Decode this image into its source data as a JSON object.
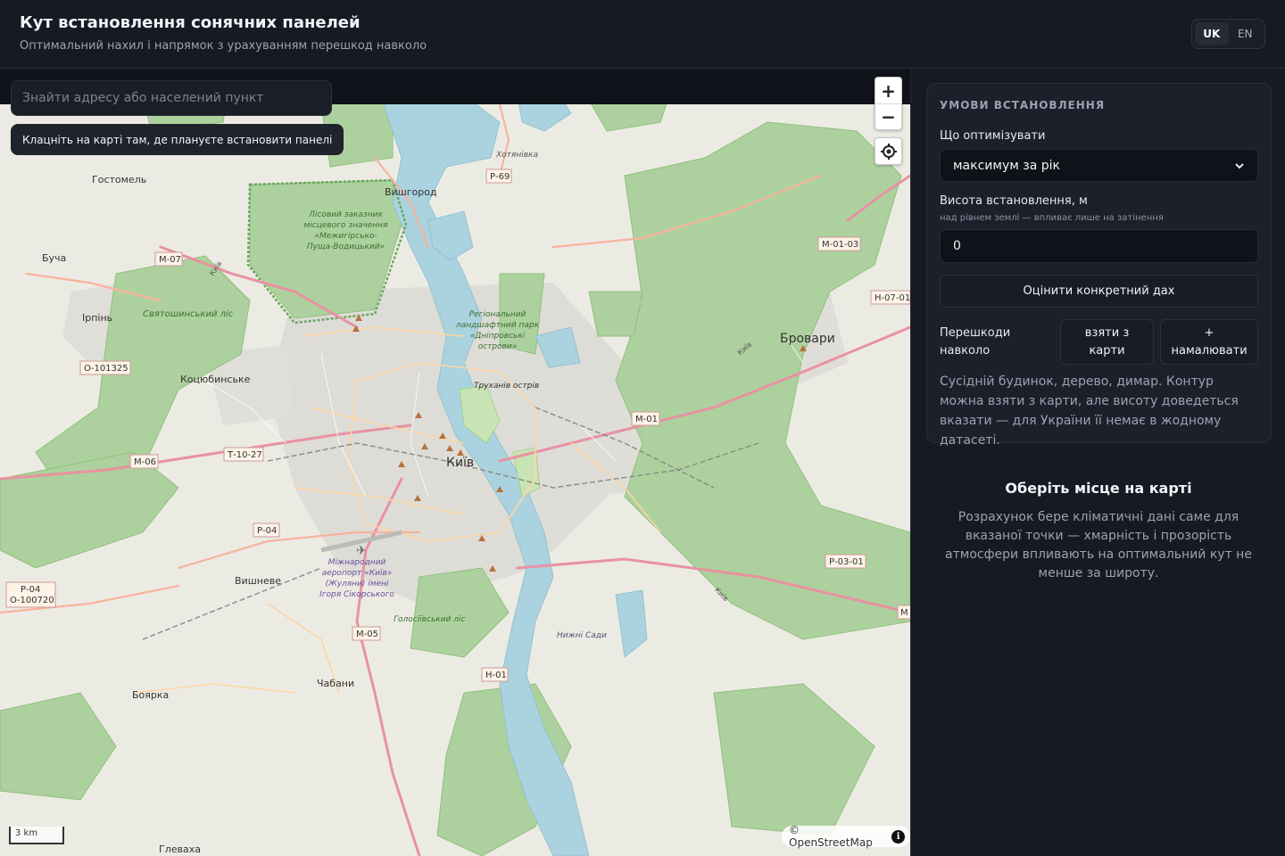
{
  "header": {
    "title": "Кут встановлення сонячних панелей",
    "subtitle": "Оптимальний нахил і напрямок з урахуванням перешкод навколо",
    "languages": [
      {
        "code": "UK",
        "active": true
      },
      {
        "code": "EN",
        "active": false
      }
    ]
  },
  "map": {
    "search_placeholder": "Знайти адресу або населений пункт",
    "hint": "Клацніть на карті там, де плануєте встановити панелі",
    "zoom_in": "+",
    "zoom_out": "−",
    "scale": "3 km",
    "attribution": "© OpenStreetMap",
    "info": "i",
    "places": {
      "kyiv": "Київ",
      "brovary": "Бровари",
      "vyshhorod": "Вишгород",
      "hostomel": "Гостомель",
      "bucha": "Буча",
      "irpin": "Ірпінь",
      "kotsiubynske": "Коцюбинське",
      "vyshneve": "Вишневе",
      "chabany": "Чабани",
      "boiarka": "Боярка",
      "hlevakha": "Глеваха",
      "khotianivka": "Хотянівка",
      "trukhaniv": "Труханів острів",
      "sviatoshynskyi": "Святошинський ліс",
      "holosiivskyi": "Голосіївський ліс",
      "nyzhni_sady": "Нижні Сади",
      "airport": "Міжнародний аеропорт «Київ» (Жуляни) імені Ігоря Сікорського",
      "dniprovski": "Регіональний ландшафтний парк «Дніпровські острови»",
      "reserve": "Лісовий заказник місцевого значення «Межигірсько-Пуща-Водицький»"
    },
    "road_labels": {
      "r69": "Р-69",
      "m07": "М-07",
      "m0103": "М-01-03",
      "h0701": "Н-07-01",
      "o101325": "О-101325",
      "m01": "М-01",
      "t1027": "Т-10-27",
      "m06": "М-06",
      "r04": "Р-04",
      "r04b": "Р-04",
      "o100720": "О-100720",
      "m05": "М-05",
      "h01": "Н-01",
      "r0301": "Р-03-01",
      "m_edge": "M",
      "kyiv_ring1": "Київ",
      "kyiv_ring2": "Київ",
      "kyiv_ring3": "Київ"
    }
  },
  "panel": {
    "section_title": "УМОВИ ВСТАНОВЛЕННЯ",
    "optimize_label": "Що оптимізувати",
    "optimize_value": "максимум за рік",
    "height_label": "Висота встановлення, м",
    "height_hint": "над рівнем землі — впливає лише на затінення",
    "height_value": "0",
    "roof_button": "Оцінити конкретний дах",
    "obstacles_label": "Перешкоди навколо",
    "from_map_button": "взяти з карти",
    "draw_button": "+ намалювати",
    "obstacles_note": "Сусідній будинок, дерево, димар. Контур можна взяти з карти, але висоту доведеться вказати — для України її немає в жодному датасеті.",
    "empty_title": "Оберіть місце на карті",
    "empty_text": "Розрахунок бере кліматичні дані саме для вказаної точки — хмарність і прозорість атмосфери впливають на оптимальний кут не менше за широту."
  }
}
